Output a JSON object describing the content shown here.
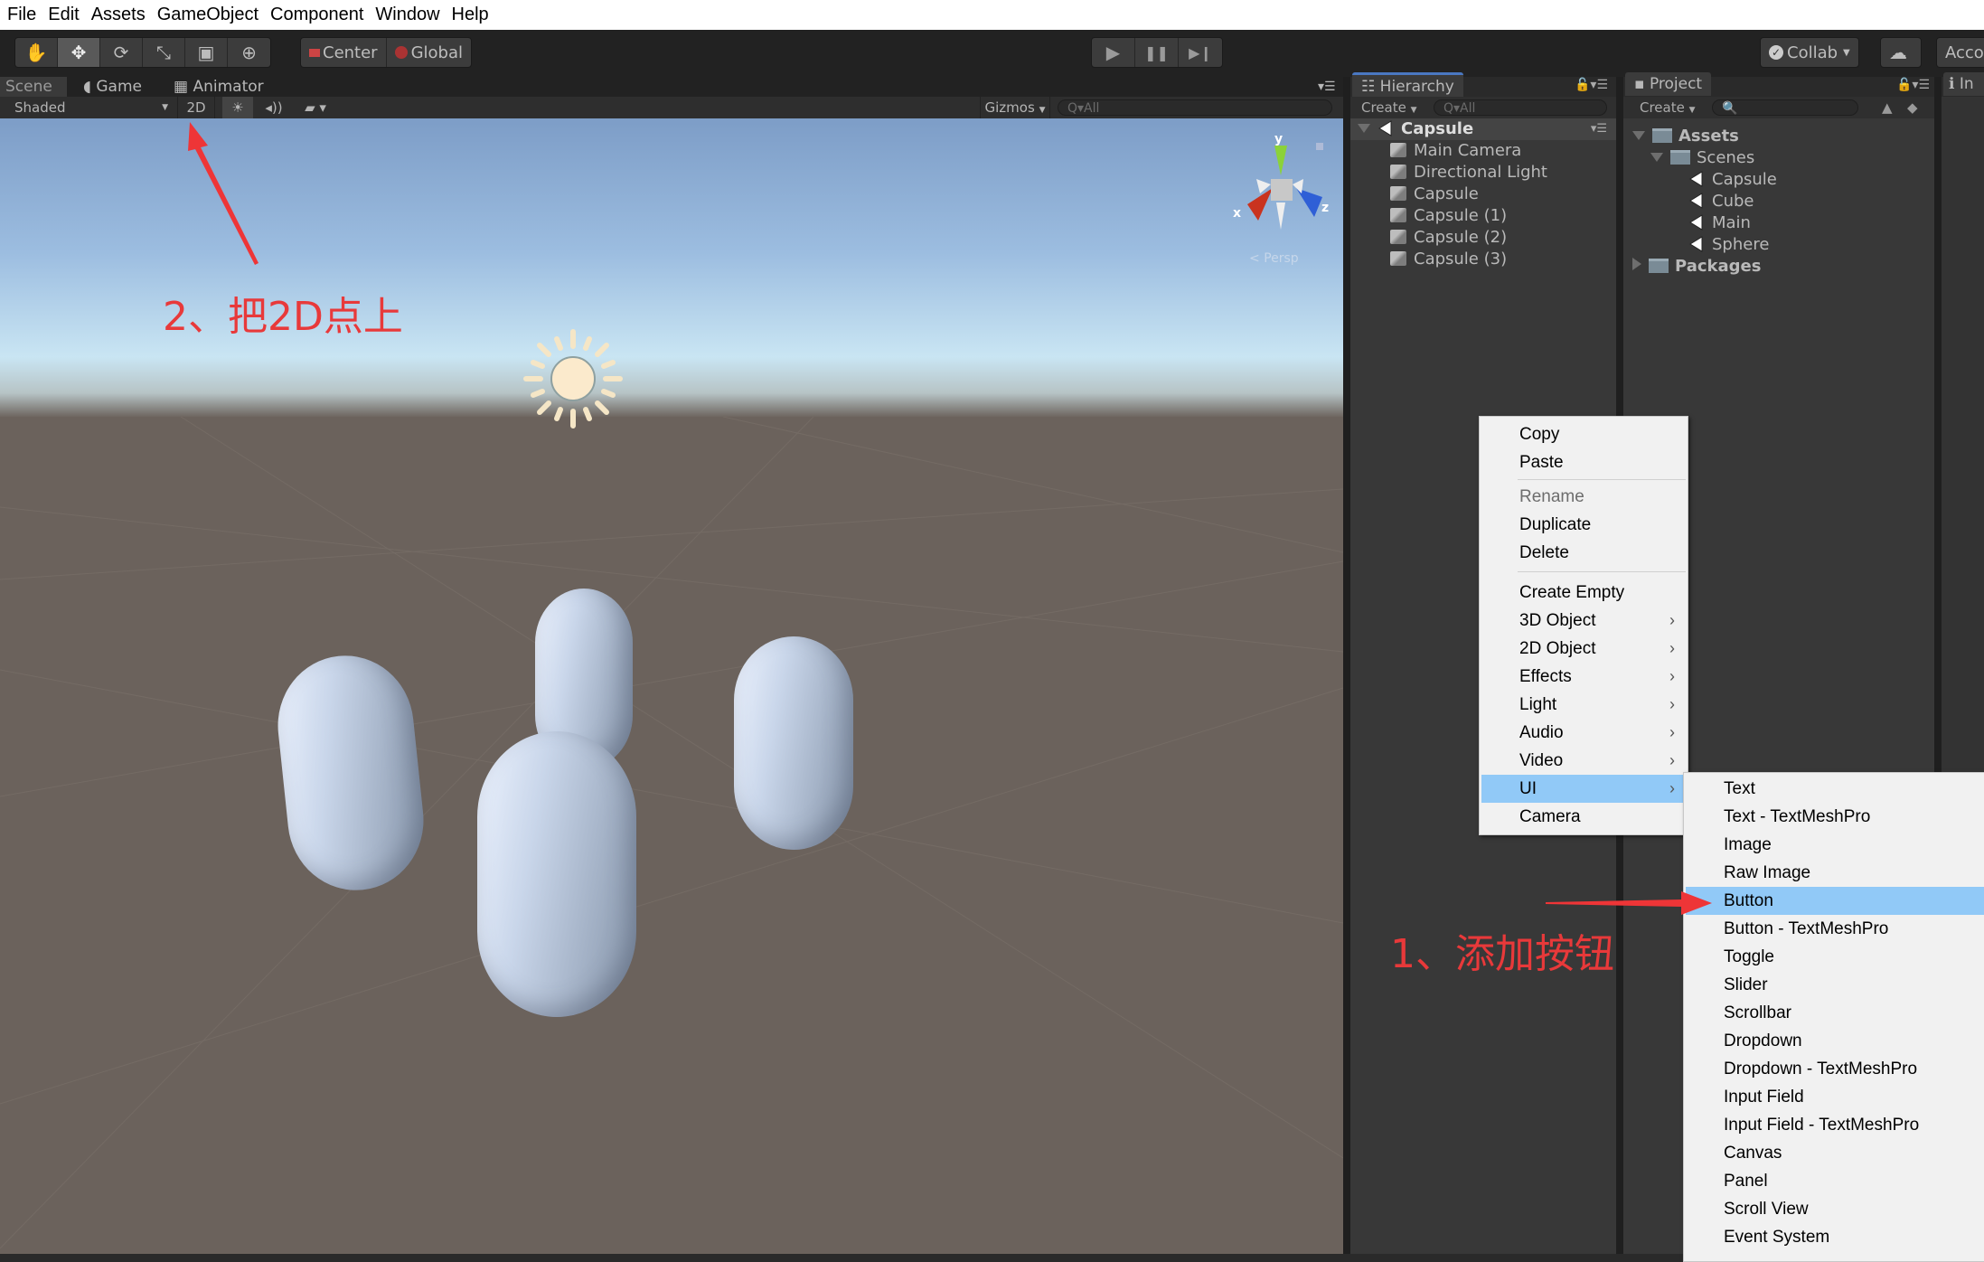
{
  "menubar": {
    "items": [
      "File",
      "Edit",
      "Assets",
      "GameObject",
      "Component",
      "Window",
      "Help"
    ]
  },
  "toolbar": {
    "transform_tools": [
      {
        "name": "hand-tool",
        "icon": "hand-icon",
        "glyph": "✋",
        "active": false
      },
      {
        "name": "move-tool",
        "icon": "move-icon",
        "glyph": "✥",
        "active": true
      },
      {
        "name": "rotate-tool",
        "icon": "rotate-icon",
        "glyph": "⟳",
        "active": false
      },
      {
        "name": "scale-tool",
        "icon": "scale-icon",
        "glyph": "⤡",
        "active": false
      },
      {
        "name": "rect-tool",
        "icon": "rect-icon",
        "glyph": "▣",
        "active": false
      },
      {
        "name": "transform-tool",
        "icon": "transform-icon",
        "glyph": "⊕",
        "active": false
      }
    ],
    "pivot_label": "Center",
    "space_label": "Global",
    "play_glyph": "▶",
    "pause_glyph": "❚❚",
    "step_glyph": "▶❙",
    "collab_label": "Collab",
    "account_label": "Accou"
  },
  "scene_panel": {
    "tabs": [
      {
        "label": "Scene",
        "active": true
      },
      {
        "label": "Game",
        "active": false
      },
      {
        "label": "Animator",
        "active": false
      }
    ],
    "shading_mode": "Shaded",
    "mode_2d_label": "2D",
    "gizmos_label": "Gizmos",
    "search_placeholder": "Q▾All",
    "axis_labels": {
      "x": "x",
      "y": "y",
      "z": "z"
    },
    "projection_label": "Persp"
  },
  "hierarchy": {
    "tab_label": "Hierarchy",
    "create_label": "Create",
    "search_placeholder": "Q▾All",
    "scene_name": "Capsule",
    "items": [
      "Main Camera",
      "Directional Light",
      "Capsule",
      "Capsule (1)",
      "Capsule (2)",
      "Capsule (3)"
    ]
  },
  "project": {
    "tab_label": "Project",
    "create_label": "Create",
    "tree": [
      {
        "label": "Assets",
        "level": 0,
        "type": "folder",
        "expanded": true,
        "bold": true
      },
      {
        "label": "Scenes",
        "level": 1,
        "type": "folder",
        "expanded": true,
        "bold": false
      },
      {
        "label": "Capsule",
        "level": 2,
        "type": "scene",
        "bold": false
      },
      {
        "label": "Cube",
        "level": 2,
        "type": "scene",
        "bold": false
      },
      {
        "label": "Main",
        "level": 2,
        "type": "scene",
        "bold": false
      },
      {
        "label": "Sphere",
        "level": 2,
        "type": "scene",
        "bold": false
      },
      {
        "label": "Packages",
        "level": 0,
        "type": "folder",
        "expanded": false,
        "bold": true
      }
    ]
  },
  "inspector": {
    "tab_label": "In"
  },
  "context_menu": {
    "items": [
      {
        "label": "Copy",
        "submenu": false,
        "disabled": false
      },
      {
        "label": "Paste",
        "submenu": false,
        "disabled": false
      },
      {
        "separator": true
      },
      {
        "label": "Rename",
        "submenu": false,
        "disabled": true
      },
      {
        "label": "Duplicate",
        "submenu": false,
        "disabled": false
      },
      {
        "label": "Delete",
        "submenu": false,
        "disabled": false
      },
      {
        "separator": true
      },
      {
        "label": "Create Empty",
        "submenu": false,
        "disabled": false
      },
      {
        "label": "3D Object",
        "submenu": true,
        "disabled": false
      },
      {
        "label": "2D Object",
        "submenu": true,
        "disabled": false
      },
      {
        "label": "Effects",
        "submenu": true,
        "disabled": false
      },
      {
        "label": "Light",
        "submenu": true,
        "disabled": false
      },
      {
        "label": "Audio",
        "submenu": true,
        "disabled": false
      },
      {
        "label": "Video",
        "submenu": true,
        "disabled": false
      },
      {
        "label": "UI",
        "submenu": true,
        "disabled": false,
        "highlighted": true
      },
      {
        "label": "Camera",
        "submenu": false,
        "disabled": false
      }
    ]
  },
  "ui_submenu": {
    "items": [
      "Text",
      "Text - TextMeshPro",
      "Image",
      "Raw Image",
      "Button",
      "Button - TextMeshPro",
      "Toggle",
      "Slider",
      "Scrollbar",
      "Dropdown",
      "Dropdown - TextMeshPro",
      "Input Field",
      "Input Field - TextMeshPro",
      "Canvas",
      "Panel",
      "Scroll View",
      "Event System"
    ],
    "highlighted": "Button"
  },
  "annotations": {
    "step2": "2、把2D点上",
    "step1": "1、添加按钮",
    "color": "#e8393a"
  },
  "colors": {
    "menu_highlight": "#91c9f7",
    "panel_bg": "#383838",
    "toolbar_bg": "#222222",
    "hierarchy_tab_accent": "#4a78c2"
  }
}
